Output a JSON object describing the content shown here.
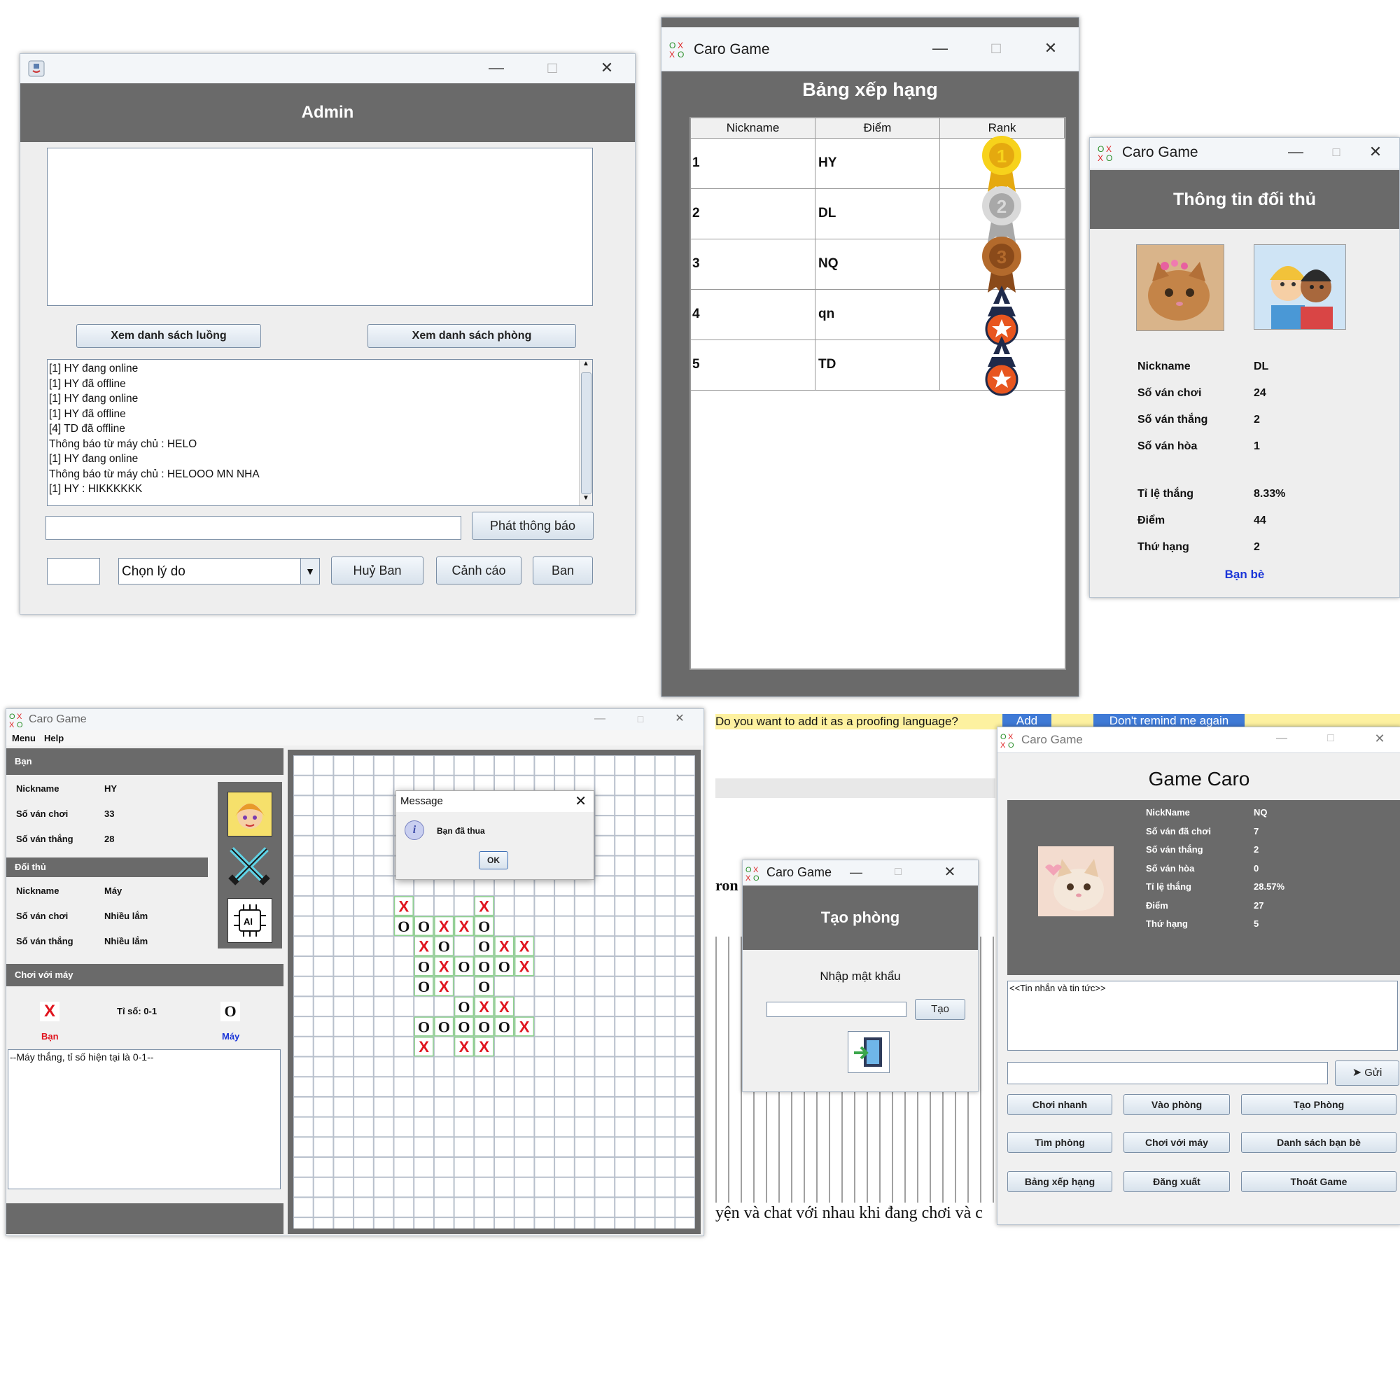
{
  "admin": {
    "header": "Admin",
    "btn_threads": "Xem danh sách luồng",
    "btn_rooms": "Xem danh sách phòng",
    "log": [
      "[1] HY đang online",
      "[1] HY đã offline",
      "[1] HY đang online",
      "[1] HY đã offline",
      "[4] TD đã offline",
      "Thông báo từ máy chủ : HELO",
      "[1] HY đang online",
      "Thông báo từ máy chủ : HELOOO MN NHA",
      "[1] HY : HIKKKKKK"
    ],
    "btn_announce": "Phát thông báo",
    "reason_select": "Chọn lý do",
    "btn_unban": "Huỷ Ban",
    "btn_warn": "Cảnh cáo",
    "btn_ban": "Ban"
  },
  "ranking": {
    "window_title": "Caro Game",
    "header": "Bảng xếp hạng",
    "columns": [
      "Nickname",
      "Điểm",
      "Rank"
    ],
    "rows": [
      {
        "col1": "1",
        "col2": "HY",
        "medal": "gold-medal-1"
      },
      {
        "col1": "2",
        "col2": "DL",
        "medal": "silver-medal-2"
      },
      {
        "col1": "3",
        "col2": "NQ",
        "medal": "bronze-medal-3"
      },
      {
        "col1": "4",
        "col2": "qn",
        "medal": "star-badge"
      },
      {
        "col1": "5",
        "col2": "TD",
        "medal": "star-badge"
      }
    ]
  },
  "opponent": {
    "window_title": "Caro Game",
    "header": "Thông tin đối thủ",
    "stats": [
      {
        "label": "Nickname",
        "value": "DL"
      },
      {
        "label": "Số ván chơi",
        "value": "24"
      },
      {
        "label": "Số ván thắng",
        "value": "2"
      },
      {
        "label": "Số ván hòa",
        "value": "1"
      },
      {
        "label": "Tỉ lệ thắng",
        "value": "8.33%"
      },
      {
        "label": "Điểm",
        "value": "44"
      },
      {
        "label": "Thứ hạng",
        "value": "2"
      }
    ],
    "friend_link": "Bạn bè"
  },
  "game": {
    "window_title": "Caro Game",
    "menu": [
      "Menu",
      "Help"
    ],
    "you_header": "Bạn",
    "you_stats": [
      {
        "label": "Nickname",
        "value": "HY"
      },
      {
        "label": "Số ván chơi",
        "value": "33"
      },
      {
        "label": "Số ván thắng",
        "value": "28"
      }
    ],
    "opp_header": "Đối thủ",
    "opp_stats": [
      {
        "label": "Nickname",
        "value": "Máy"
      },
      {
        "label": "Số ván chơi",
        "value": "Nhiều lắm"
      },
      {
        "label": "Số ván thắng",
        "value": "Nhiều lắm"
      }
    ],
    "ai_header": "Chơi với máy",
    "score": "Tỉ số: 0-1",
    "player_label": "Bạn",
    "machine_label": "Máy",
    "x_mark": "X",
    "o_mark": "O",
    "chat_log": "--Máy thắng, tỉ số hiện tại là 0-1--",
    "dialog_title": "Message",
    "dialog_text": "Bạn đã thua",
    "dialog_ok": "OK",
    "board": [
      ".X...X...",
      ".OOXXO...",
      "..XO.OXX.",
      "..OXOOOX.",
      "..OX.O...",
      "....OXX..",
      "..OOOOOX.",
      "..X.XX..."
    ]
  },
  "word_bar": {
    "question": "Do you want to add it as a proofing language?",
    "add": "Add",
    "dont_remind": "Don't remind me again",
    "text_fragment_left": "ron",
    "bottom_text": "yện và chat với nhau khi đang chơi và c"
  },
  "create_room": {
    "window_title": "Caro Game",
    "header": "Tạo phòng",
    "password_label": "Nhập mật khẩu",
    "btn_create": "Tạo"
  },
  "lobby": {
    "window_title": "Caro Game",
    "title": "Game Caro",
    "stats": [
      {
        "label": "NickName",
        "value": "NQ"
      },
      {
        "label": "Số ván đã chơi",
        "value": "7"
      },
      {
        "label": "Số ván thắng",
        "value": "2"
      },
      {
        "label": "Số ván hòa",
        "value": "0"
      },
      {
        "label": "Tỉ lệ thắng",
        "value": "28.57%"
      },
      {
        "label": "Điểm",
        "value": "27"
      },
      {
        "label": "Thứ hạng",
        "value": "5"
      }
    ],
    "news": "<<Tin nhắn và tin tức>>",
    "btn_send": "Gửi",
    "buttons": [
      "Chơi nhanh",
      "Vào phòng",
      "Tạo Phòng",
      "Tìm phòng",
      "Chơi với máy",
      "Danh sách bạn bè",
      "Bảng xếp hạng",
      "Đăng xuất",
      "Thoát Game"
    ]
  },
  "colors": {
    "header_gray": "#6a6a6a",
    "x_red": "#e0141e",
    "link_blue": "#1a35d8"
  }
}
